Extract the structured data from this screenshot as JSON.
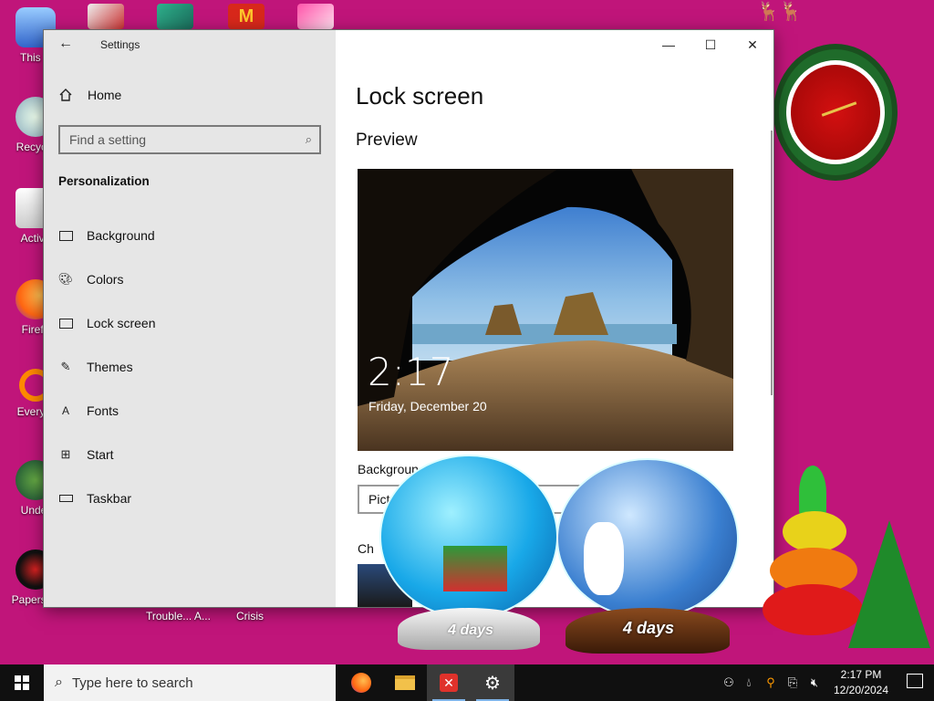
{
  "desktop": {
    "icons": [
      {
        "label": "This P"
      },
      {
        "label": "Recycle"
      },
      {
        "label": "Activa"
      },
      {
        "label": "Firefo"
      },
      {
        "label": "Everyth"
      },
      {
        "label": "Under"
      },
      {
        "label": "Papers, P"
      }
    ],
    "under_labels": [
      "Trouble... A...",
      "Crisis"
    ],
    "snowglobe_left_text": "4 days",
    "snowglobe_right_text": "4 days"
  },
  "window": {
    "app_title": "Settings",
    "controls": {
      "minimize": "—",
      "maximize": "☐",
      "close": "✕"
    }
  },
  "sidebar": {
    "home_label": "Home",
    "search_placeholder": "Find a setting",
    "section_title": "Personalization",
    "items": [
      {
        "label": "Background",
        "icon": "picture-icon"
      },
      {
        "label": "Colors",
        "icon": "palette-icon"
      },
      {
        "label": "Lock screen",
        "icon": "lock-screen-icon"
      },
      {
        "label": "Themes",
        "icon": "themes-icon"
      },
      {
        "label": "Fonts",
        "icon": "fonts-icon"
      },
      {
        "label": "Start",
        "icon": "start-icon"
      },
      {
        "label": "Taskbar",
        "icon": "taskbar-icon"
      }
    ]
  },
  "content": {
    "page_title": "Lock screen",
    "preview_label": "Preview",
    "preview_time": "2:17",
    "preview_date": "Friday, December 20",
    "background_label": "Backgroun",
    "background_value": "Pict",
    "choose_label": "Ch"
  },
  "taskbar": {
    "search_placeholder": "Type here to search",
    "clock_time": "2:17 PM",
    "clock_date": "12/20/2024"
  },
  "colors": {
    "desktop": "#c0157a",
    "sidebar": "#e6e6e6",
    "taskbar": "#101010"
  }
}
